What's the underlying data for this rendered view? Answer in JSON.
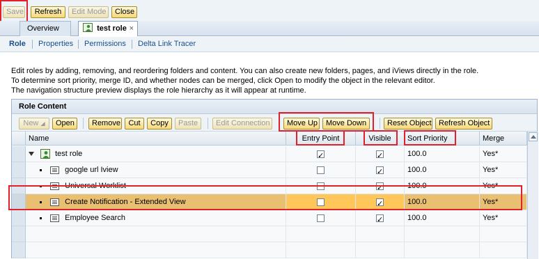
{
  "toolbar": {
    "save": "Save",
    "refresh": "Refresh",
    "edit_mode": "Edit Mode",
    "close": "Close"
  },
  "tabs": [
    {
      "label": "Overview"
    },
    {
      "label": "test role",
      "close": "×"
    }
  ],
  "subnav": [
    "Role",
    "Properties",
    "Permissions",
    "Delta Link Tracer"
  ],
  "description": [
    "Edit roles by adding, removing, and reordering folders and content. You can also create new folders, pages, and iViews directly in the role.",
    "To determine sort priority, merge ID, and whether nodes can be merged, click Open to modify the object in the relevant editor.",
    "The navigation structure preview displays the role hierarchy as it will appear at runtime."
  ],
  "panel": {
    "title": "Role Content",
    "buttons": {
      "new": "New",
      "open": "Open",
      "remove": "Remove",
      "cut": "Cut",
      "copy": "Copy",
      "paste": "Paste",
      "edit_connection": "Edit Connection",
      "move_up": "Move Up",
      "move_down": "Move Down",
      "reset_object": "Reset Object",
      "refresh_object": "Refresh Object"
    },
    "columns": {
      "name": "Name",
      "entry_point": "Entry Point",
      "visible": "Visible",
      "sort_priority": "Sort Priority",
      "merge": "Merge"
    },
    "rows": [
      {
        "name": "test role",
        "entry_point": true,
        "visible": true,
        "sort_priority": "100.0",
        "merge": "Yes*"
      },
      {
        "name": "google url Iview",
        "entry_point": false,
        "visible": true,
        "sort_priority": "100.0",
        "merge": "Yes*"
      },
      {
        "name": "Universal Worklist",
        "entry_point": false,
        "visible": true,
        "sort_priority": "100.0",
        "merge": "Yes*"
      },
      {
        "name": "Create Notification - Extended View",
        "entry_point": false,
        "visible": true,
        "sort_priority": "100.0",
        "merge": "Yes*",
        "selected": true
      },
      {
        "name": "Employee Search",
        "entry_point": false,
        "visible": true,
        "sort_priority": "100.0",
        "merge": "Yes*"
      }
    ]
  },
  "colors": {
    "highlight_annotation": "#e0202a",
    "selected_row": "#e9bf72",
    "link_blue": "#1a4f8a"
  }
}
